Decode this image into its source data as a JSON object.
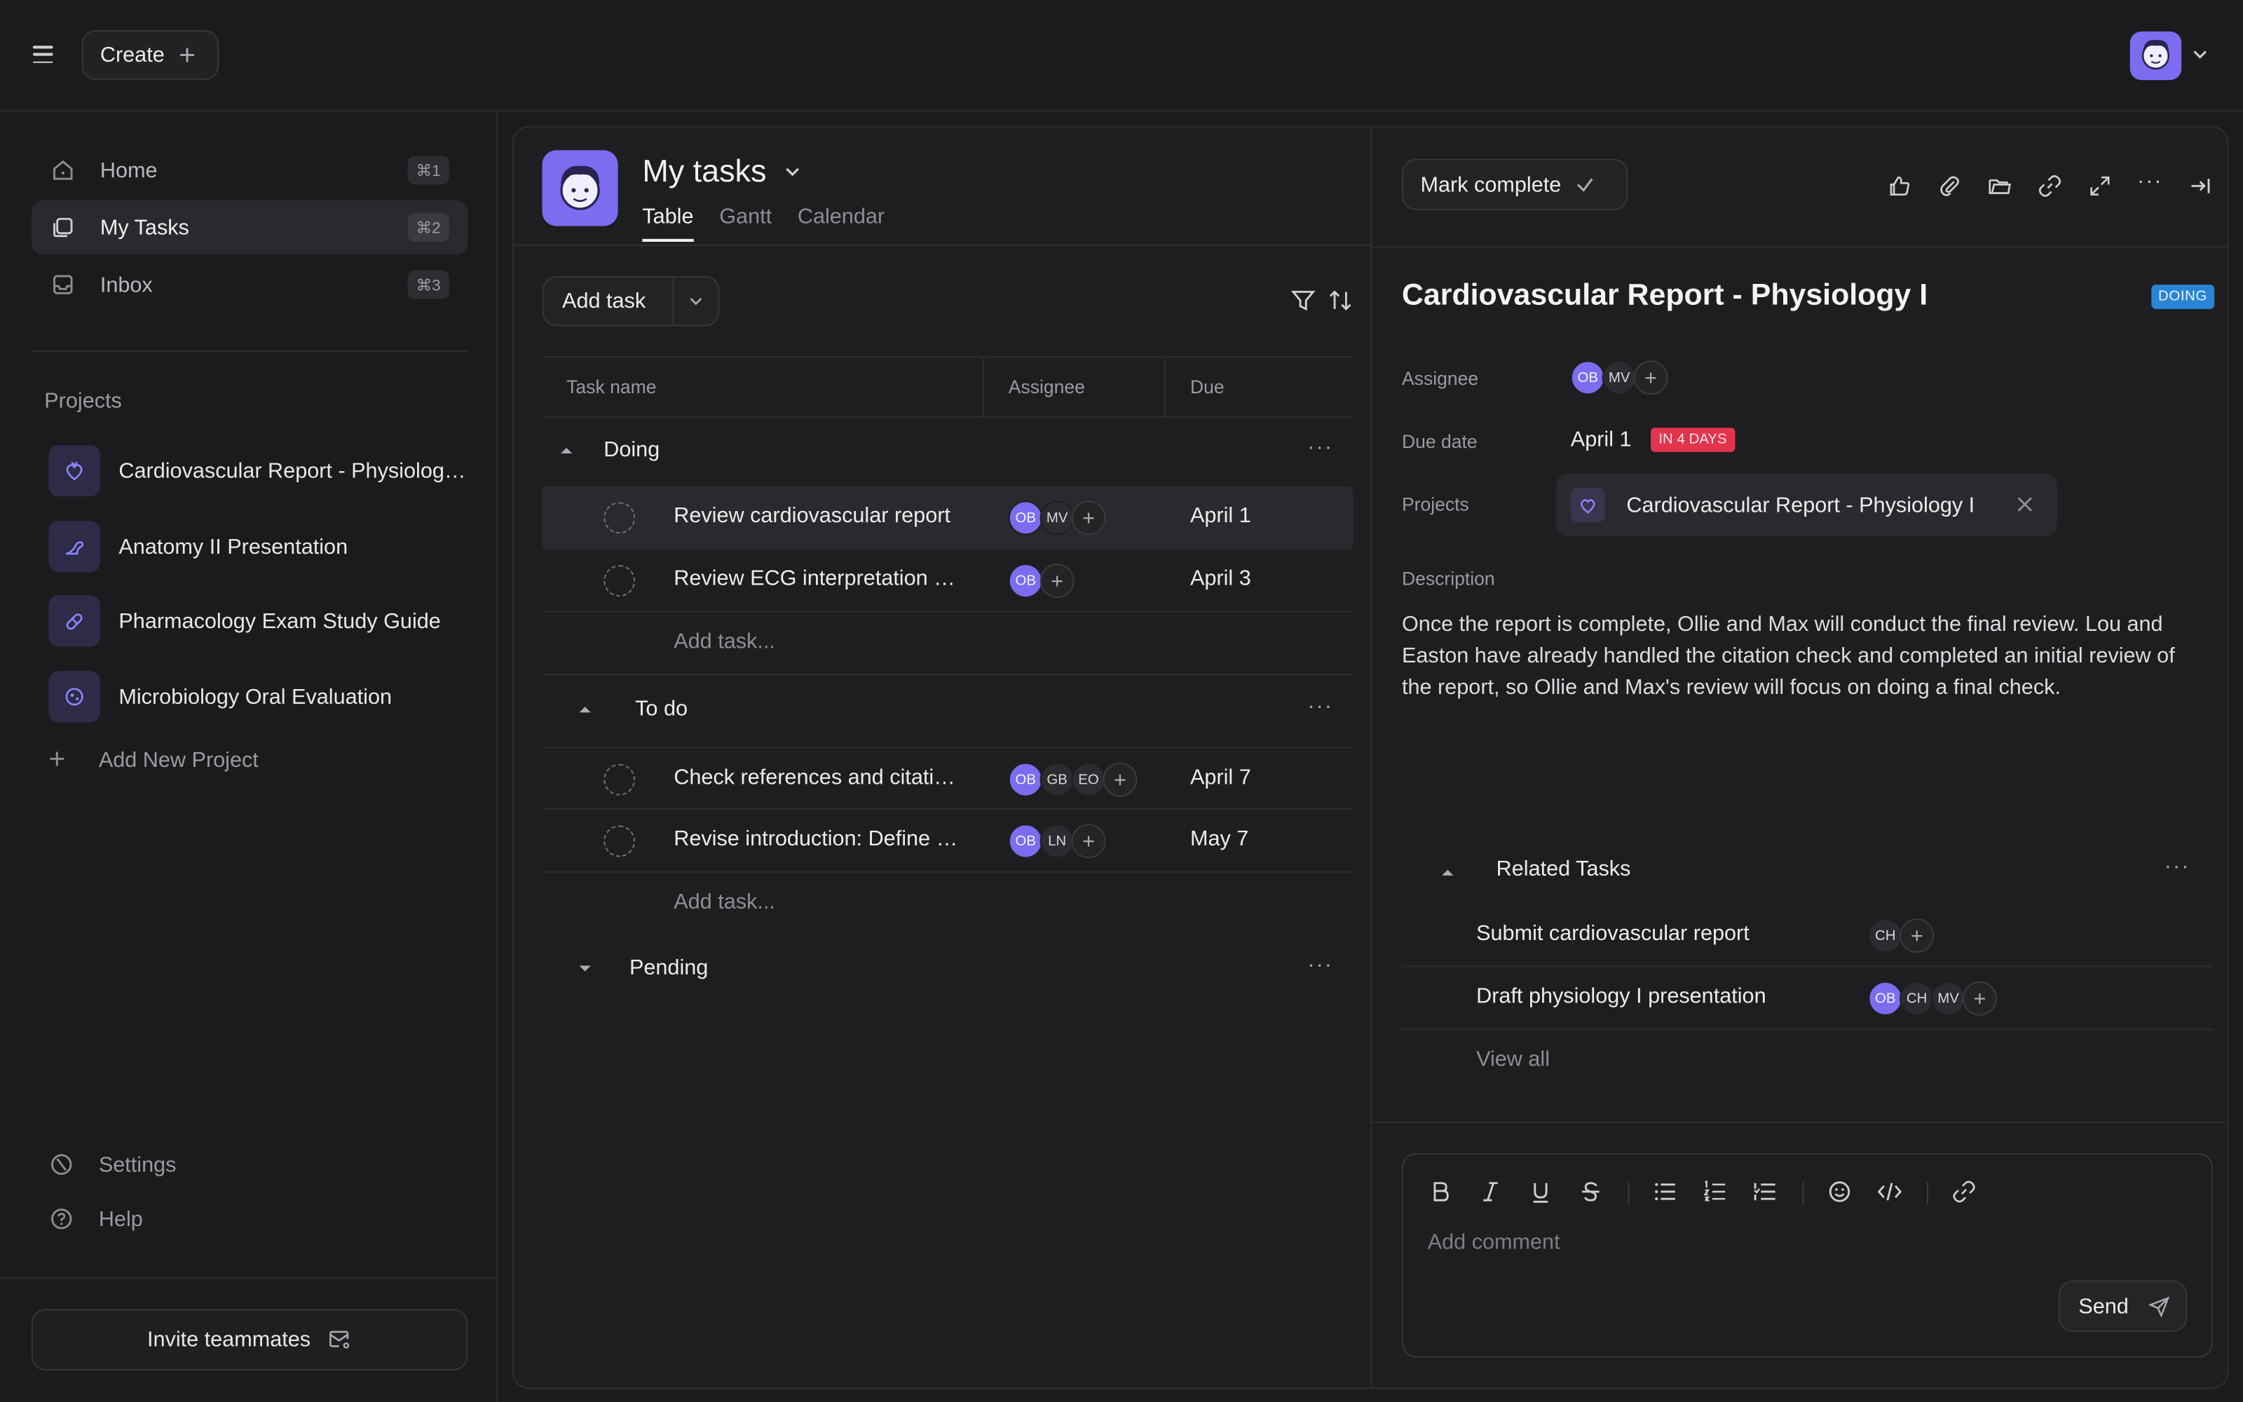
{
  "topbar": {
    "create_label": "Create"
  },
  "sidebar": {
    "nav": [
      {
        "label": "Home",
        "shortcut": "⌘1"
      },
      {
        "label": "My Tasks",
        "shortcut": "⌘2"
      },
      {
        "label": "Inbox",
        "shortcut": "⌘3"
      }
    ],
    "projects_title": "Projects",
    "projects": [
      {
        "label": "Cardiovascular Report - Physiology I",
        "icon": "heart-icon"
      },
      {
        "label": "Anatomy II Presentation",
        "icon": "arm-icon"
      },
      {
        "label": "Pharmacology Exam Study Guide",
        "icon": "pill-icon"
      },
      {
        "label": "Microbiology Oral Evaluation",
        "icon": "microbe-icon"
      }
    ],
    "add_project_label": "Add New Project",
    "settings_label": "Settings",
    "help_label": "Help",
    "invite_label": "Invite teammates"
  },
  "my_tasks": {
    "title": "My tasks",
    "tabs": [
      "Table",
      "Gantt",
      "Calendar"
    ],
    "add_task_label": "Add task",
    "columns": {
      "name": "Task name",
      "assignee": "Assignee",
      "due": "Due"
    },
    "groups": [
      {
        "name": "Doing",
        "tasks": [
          {
            "name": "Review cardiovascular report",
            "assignees": [
              "OB",
              "MV"
            ],
            "due": "April 1"
          },
          {
            "name": "Review ECG interpretation section",
            "assignees": [
              "OB"
            ],
            "due": "April 3"
          }
        ]
      },
      {
        "name": "To do",
        "tasks": [
          {
            "name": "Check references and citations",
            "assignees": [
              "OB",
              "GB",
              "EO"
            ],
            "due": "April 7"
          },
          {
            "name": "Revise introduction: Define key terms",
            "assignees": [
              "OB",
              "LN"
            ],
            "due": "May 7"
          }
        ]
      },
      {
        "name": "Pending",
        "tasks": []
      }
    ],
    "add_task_row_label": "Add task..."
  },
  "detail": {
    "mark_complete_label": "Mark complete",
    "title": "Cardiovascular Report - Physiology I",
    "status_badge": "DOING",
    "assignee_label": "Assignee",
    "assignees": [
      "OB",
      "MV"
    ],
    "due_date_label": "Due date",
    "due_date": "April 1",
    "due_badge": "IN 4 DAYS",
    "projects_label": "Projects",
    "project": "Cardiovascular Report - Physiology I",
    "description_label": "Description",
    "description": "Once the report is complete, Ollie and Max will conduct the final review. Lou and Easton have already handled the citation check and completed an initial review of the report, so Ollie and Max's review will focus on doing a final check.",
    "related_title": "Related Tasks",
    "related": [
      {
        "name": "Submit cardiovascular report",
        "assignees": [
          "CH"
        ]
      },
      {
        "name": "Draft physiology I presentation",
        "assignees": [
          "OB",
          "CH",
          "MV"
        ]
      }
    ],
    "view_all_label": "View all",
    "comment_placeholder": "Add comment",
    "send_label": "Send"
  },
  "colors": {
    "accent": "#7b6cf0",
    "doing_badge": "#2a84d6",
    "due_badge": "#e3344d",
    "background": "#1b1b1d"
  }
}
